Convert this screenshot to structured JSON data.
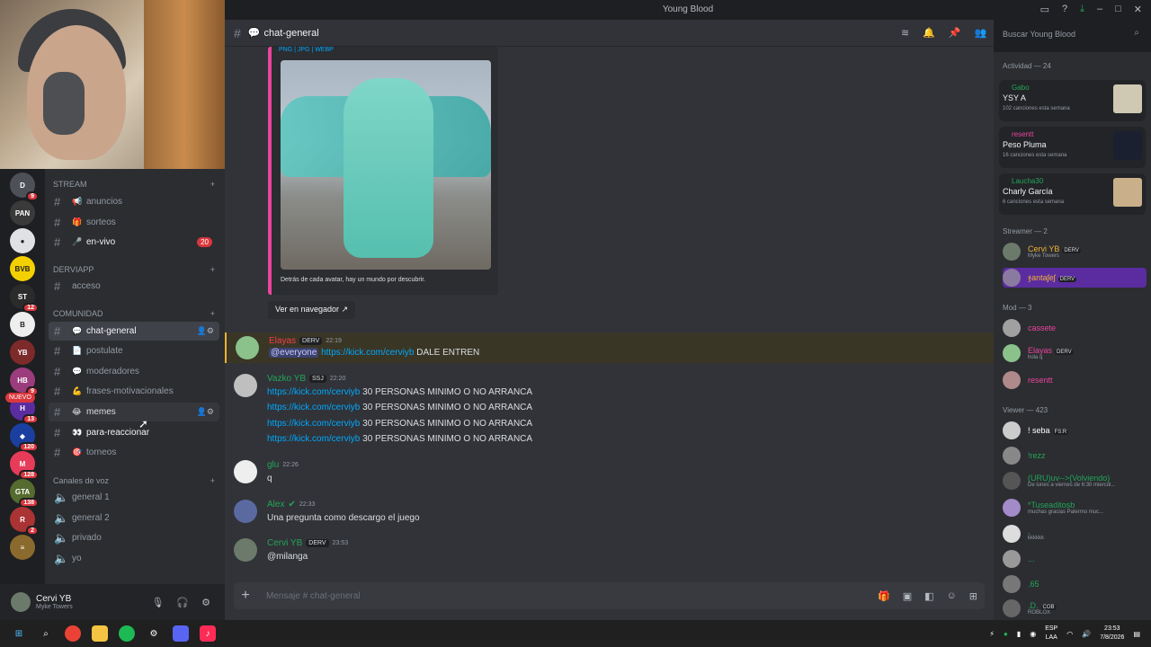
{
  "window": {
    "title": "Young Blood"
  },
  "servers": [
    {
      "label": "D",
      "badge": "9",
      "color": "#4e5058"
    },
    {
      "label": "PAN",
      "badge": "",
      "color": "#3a3a3a"
    },
    {
      "label": "●",
      "badge": "",
      "color": "#dfe1e5"
    },
    {
      "label": "BVB",
      "badge": "",
      "color": "#f5d000"
    },
    {
      "label": "ST",
      "badge": "12",
      "color": "#2b2b2b"
    },
    {
      "label": "B",
      "badge": "",
      "color": "#eeeeee"
    },
    {
      "label": "YB",
      "badge": "",
      "color": "#7d2a2a"
    },
    {
      "label": "HB",
      "badge": "9",
      "color": "#9b3c7d"
    },
    {
      "label": "H",
      "badge": "13",
      "color": "#5b2ca0"
    },
    {
      "label": "◆",
      "badge": "120",
      "color": "#1a3fa0"
    },
    {
      "label": "M",
      "badge": "128",
      "color": "#e63c5a"
    },
    {
      "label": "GTA",
      "badge": "138",
      "color": "#556b2f"
    },
    {
      "label": "R",
      "badge": "2",
      "color": "#a33"
    },
    {
      "label": "≡",
      "badge": "",
      "color": "#8b6a2e"
    }
  ],
  "nuevo_label": "NUEVO",
  "categories": {
    "stream": "STREAM",
    "derviapp": "DERVIAPP",
    "comunidad": "COMUNIDAD",
    "voz": "Canales de voz"
  },
  "channels": {
    "anuncios": "anuncios",
    "sorteos": "sorteos",
    "en_vivo": "en-vivo",
    "en_vivo_count": "20",
    "acceso": "acceso",
    "chat_general": "chat-general",
    "postulate": "postulate",
    "moderadores": "moderadores",
    "frases": "frases-motivacionales",
    "memes": "memes",
    "para_reaccionar": "para-reaccionar",
    "torneos": "torneos",
    "general1": "general 1",
    "general2": "general 2",
    "privado": "privado",
    "yo": "yo"
  },
  "user": {
    "name": "Cervi YB",
    "status": "Myke Towers"
  },
  "header": {
    "channel": "chat-general"
  },
  "search": {
    "placeholder": "Buscar Young Blood"
  },
  "embed": {
    "formats": "PNG | JPG | WEBP",
    "description": "Detrás de cada avatar, hay un mundo por descubrir.",
    "button": "Ver en navegador"
  },
  "messages": [
    {
      "author": "Elayas",
      "tag": "DERV",
      "time": "22:19",
      "color": "#f23f43",
      "mention": "@everyone",
      "link": "https://kick.com/cerviyb",
      "text": "DALE ENTREN"
    },
    {
      "author": "Vazko YB",
      "tag": "SSJ",
      "time": "22:20",
      "color": "#23a559",
      "link": "https://kick.com/cerviyb",
      "text": "30 PERSONAS MINIMO O NO ARRANCA"
    },
    {
      "author": "glu",
      "time": "22:26",
      "color": "#23a559",
      "text": "q"
    },
    {
      "author": "Alex",
      "time": "22:33",
      "color": "#23a559",
      "text": "Una pregunta como descargo el juego"
    },
    {
      "author": "Cervi YB",
      "tag": "DERV",
      "time": "23:53",
      "color": "#23a559",
      "text": "@milanga"
    }
  ],
  "composer": {
    "placeholder": "Mensaje # chat-general"
  },
  "members": {
    "activity_title": "Actividad — 24",
    "activities": [
      {
        "user": "Gabo",
        "song": "YSY A",
        "count": "102 canciones esta semana"
      },
      {
        "user": "resentt",
        "song": "Peso Pluma",
        "count": "16 canciones esta semana"
      },
      {
        "user": "Laucha30",
        "song": "Charly García",
        "count": "6 canciones esta semana"
      }
    ],
    "streamer_title": "Streamer — 2",
    "streamers": [
      {
        "name": "Cervi YB",
        "tag": "DERV",
        "status": "Myke Towers",
        "color": "#23a559"
      },
      {
        "name": "ჯantaʃeʃ",
        "tag": "DERV",
        "status": "",
        "color": "#f0b232"
      }
    ],
    "mod_title": "Mod — 3",
    "mods": [
      {
        "name": "cassete",
        "tag": "",
        "status": "",
        "color": "#eb459e"
      },
      {
        "name": "Elayas",
        "tag": "DERV",
        "status": "hola q",
        "color": "#eb459e"
      },
      {
        "name": "resentt",
        "tag": "",
        "status": "",
        "color": "#eb459e"
      }
    ],
    "viewer_title": "Viewer — 423",
    "viewers": [
      {
        "name": "! seba",
        "tag": "FS:R",
        "status": ""
      },
      {
        "name": "!rezz",
        "tag": "",
        "status": ""
      },
      {
        "name": "(URU)uv-->(Volviendo)",
        "tag": "",
        "status": "De lunes a viernes de 6:30 miercol..."
      },
      {
        "name": "*Tuseaditosb",
        "tag": "",
        "status": "muchas gracias Palermo muc..."
      },
      {
        "name": ",",
        "tag": "",
        "status": "kkkkkk"
      },
      {
        "name": "...",
        "tag": "",
        "status": ""
      },
      {
        "name": ".65",
        "tag": "",
        "status": ""
      },
      {
        "name": ".D.",
        "tag": "COB",
        "status": "ROBLOX"
      }
    ]
  },
  "taskbar": {
    "lang1": "ESP",
    "lang2": "LAA",
    "time": "23:53",
    "date": "7/8/2026"
  }
}
